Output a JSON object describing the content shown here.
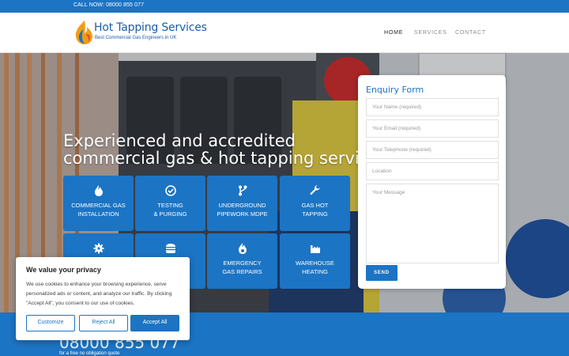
{
  "topbar": {
    "call": "CALL NOW: 08000 855 077"
  },
  "logo": {
    "title": "Hot Tapping Services",
    "subtitle": "Best Commercial Gas Engineers in UK"
  },
  "nav": {
    "items": [
      "HOME",
      "SERVICES",
      "CONTACT"
    ],
    "active": "HOME"
  },
  "hero": {
    "title_line1": "Experienced and accredited",
    "title_line2": "commercial gas & hot tapping services"
  },
  "services": [
    {
      "line1": "COMMERCIAL GAS",
      "line2": "INSTALLATION",
      "icon": "flame-icon"
    },
    {
      "line1": "TESTING",
      "line2": "& PURGING",
      "icon": "check-circle-icon"
    },
    {
      "line1": "UNDERGROUND",
      "line2": "PIPEWORK MDPE",
      "icon": "branch-icon"
    },
    {
      "line1": "GAS HOT",
      "line2": "TAPPING",
      "icon": "wrench-icon"
    },
    {
      "line1": "",
      "line2": "",
      "icon": "gear-icon"
    },
    {
      "line1": "",
      "line2": "",
      "icon": "burger-icon"
    },
    {
      "line1": "EMERGENCY",
      "line2": "GAS REPAIRS",
      "icon": "fire-icon"
    },
    {
      "line1": "WAREHOUSE",
      "line2": "HEATING",
      "icon": "factory-icon"
    }
  ],
  "form": {
    "title": "Enquiry Form",
    "name_placeholder": "Your Name (required)",
    "email_placeholder": "Your Email (required)",
    "phone_placeholder": "Your Telephone (required)",
    "location_placeholder": "Location",
    "message_placeholder": "Your Message",
    "send_label": "SEND"
  },
  "bottom": {
    "phone": "08000 855 077",
    "quote": "for a free no obligation quote"
  },
  "cookie": {
    "title": "We value your privacy",
    "text": "We use cookies to enhance your browsing experience, serve personalized ads or content, and analyze our traffic. By clicking \"Accept All\", you consent to our use of cookies.",
    "customize": "Customize",
    "reject": "Reject All",
    "accept": "Accept All"
  },
  "colors": {
    "brand": "#1c74c4",
    "logo_text": "#1a5ea8"
  }
}
